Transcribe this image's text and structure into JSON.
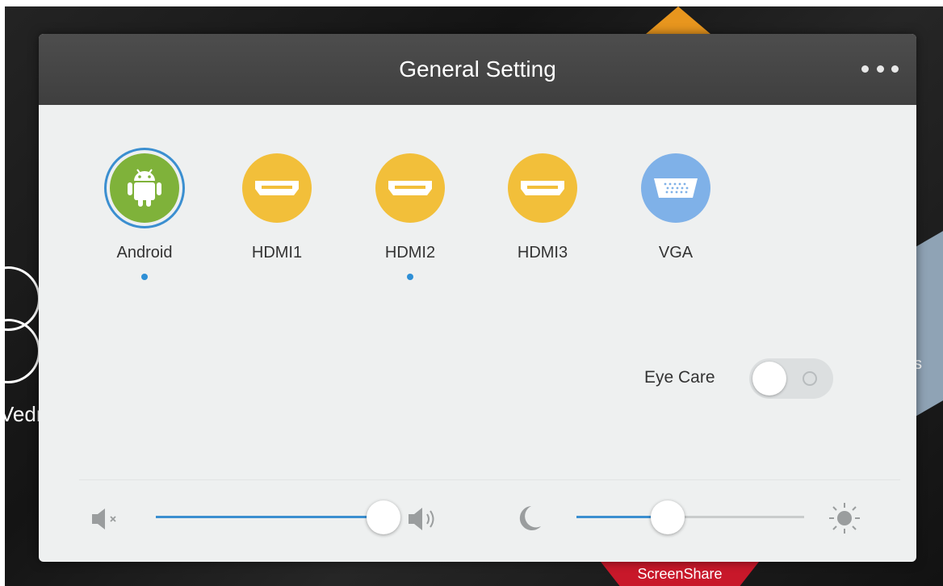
{
  "background": {
    "date_fragment": "Vedr",
    "tile_fragment": "s",
    "screenshare_label": "ScreenShare"
  },
  "dialog": {
    "title": "General Setting",
    "more_icon": "more-horizontal-icon"
  },
  "sources": [
    {
      "label": "Android",
      "icon": "android-icon",
      "selected": true,
      "indicator": true
    },
    {
      "label": "HDMI1",
      "icon": "hdmi-icon",
      "selected": false,
      "indicator": false
    },
    {
      "label": "HDMI2",
      "icon": "hdmi-icon",
      "selected": false,
      "indicator": true
    },
    {
      "label": "HDMI3",
      "icon": "hdmi-icon",
      "selected": false,
      "indicator": false
    },
    {
      "label": "VGA",
      "icon": "vga-icon",
      "selected": false,
      "indicator": false
    }
  ],
  "eye_care": {
    "label": "Eye Care",
    "enabled": false
  },
  "volume": {
    "min_icon": "mute-icon",
    "max_icon": "volume-up-icon",
    "level": 1.0
  },
  "brightness": {
    "min_icon": "moon-icon",
    "max_icon": "sun-icon",
    "level": 0.4
  },
  "colors": {
    "accent": "#3b8fd0",
    "android": "#7fb23a",
    "hdmi": "#f2bf3a",
    "vga": "#7fb1e8",
    "header": "#444444"
  }
}
